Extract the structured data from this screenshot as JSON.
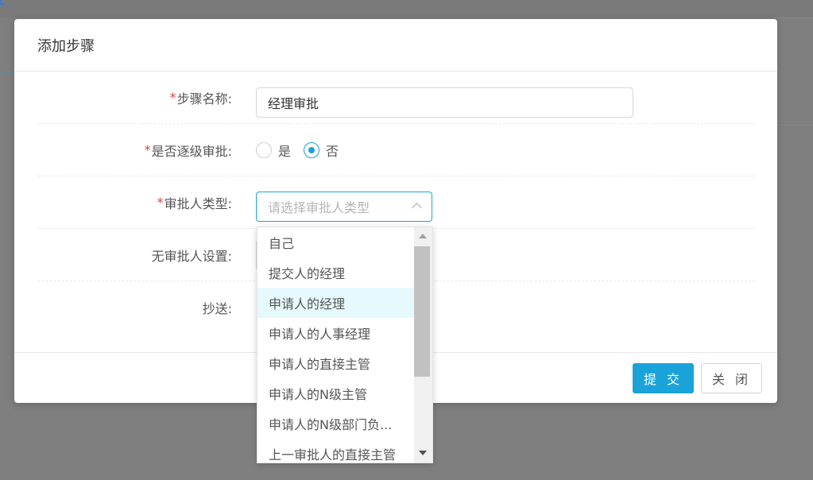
{
  "dialog": {
    "title": "添加步骤",
    "fields": {
      "step_name": {
        "label": "步骤名称:",
        "required": true,
        "value": "经理审批"
      },
      "level_approval": {
        "label": "是否逐级审批:",
        "required": true,
        "options": [
          "是",
          "否"
        ],
        "selected": "否"
      },
      "approver_type": {
        "label": "审批人类型:",
        "required": true,
        "placeholder": "请选择审批人类型"
      },
      "no_approver": {
        "label": "无审批人设置:",
        "required": false
      },
      "cc": {
        "label": "抄送:",
        "required": false
      }
    },
    "buttons": {
      "submit": "提 交",
      "close": "关 闭"
    }
  },
  "dropdown": {
    "items": [
      "自己",
      "提交人的经理",
      "申请人的经理",
      "申请人的人事经理",
      "申请人的直接主管",
      "申请人的N级主管",
      "申请人的N级部门负...",
      "上一审批人的直接主管"
    ],
    "highlighted_index": 2
  },
  "colors": {
    "accent": "#1aa3d9",
    "required": "#e04040",
    "highlight": "#e6f9fc"
  }
}
